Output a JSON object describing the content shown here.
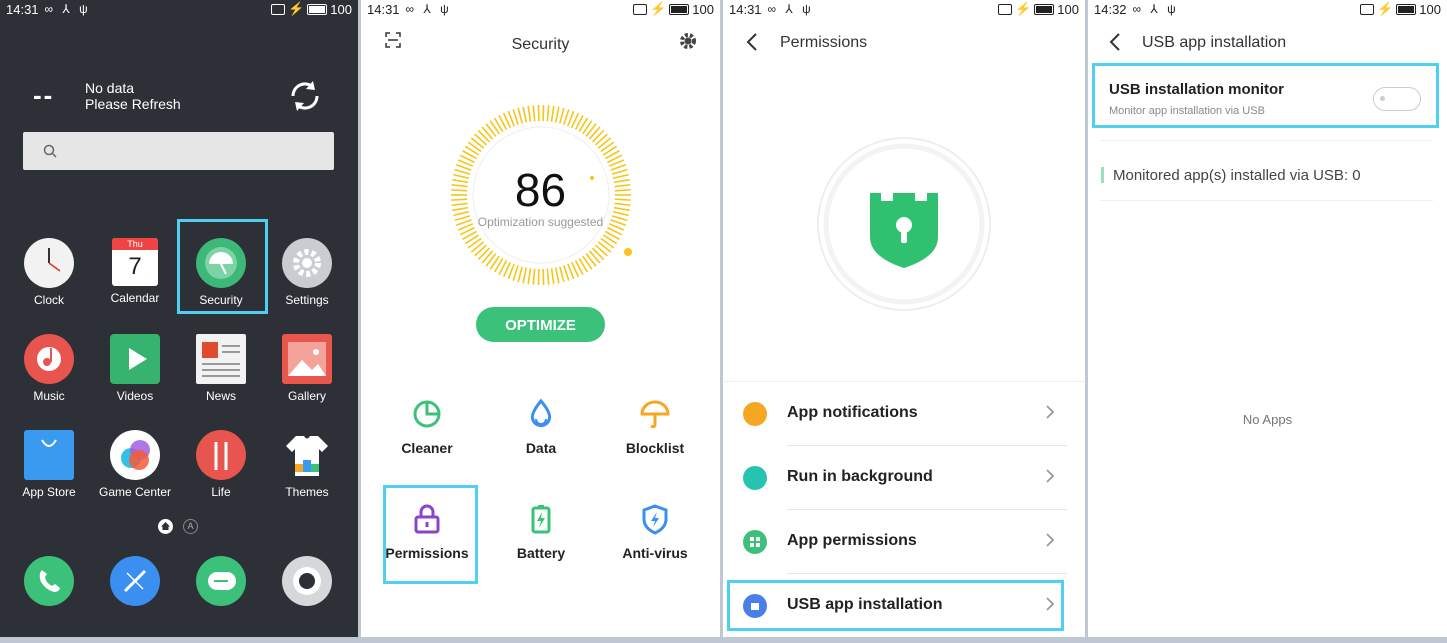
{
  "panel1": {
    "status": {
      "time": "14:31",
      "icons": "∞ ⅄ ψ",
      "battery": "100"
    },
    "weather": {
      "temp": "--",
      "line1": "No data",
      "line2": "Please Refresh"
    },
    "apps": [
      {
        "label": "Clock"
      },
      {
        "label": "Calendar"
      },
      {
        "label": "Security"
      },
      {
        "label": "Settings"
      },
      {
        "label": "Music"
      },
      {
        "label": "Videos"
      },
      {
        "label": "News"
      },
      {
        "label": "Gallery"
      },
      {
        "label": "App Store"
      },
      {
        "label": "Game Center"
      },
      {
        "label": "Life"
      },
      {
        "label": "Themes"
      }
    ],
    "calendar": {
      "day": "Thu",
      "date": "7"
    },
    "dock_dot": "A"
  },
  "panel2": {
    "status": {
      "time": "14:31",
      "icons": "∞ ⅄ ψ",
      "battery": "100"
    },
    "title": "Security",
    "score": "86",
    "score_sub": "Optimization suggested",
    "optimize_label": "OPTIMIZE",
    "tools": [
      {
        "label": "Cleaner"
      },
      {
        "label": "Data"
      },
      {
        "label": "Blocklist"
      },
      {
        "label": "Permissions"
      },
      {
        "label": "Battery"
      },
      {
        "label": "Anti-virus"
      }
    ]
  },
  "panel3": {
    "status": {
      "time": "14:31",
      "icons": "∞ ⅄ ψ",
      "battery": "100"
    },
    "title": "Permissions",
    "rows": [
      {
        "label": "App notifications",
        "color": "#f5a623"
      },
      {
        "label": "Run in background",
        "color": "#26c3b0"
      },
      {
        "label": "App permissions",
        "color": "#3cc17a"
      },
      {
        "label": "USB app installation",
        "color": "#4a7fe8"
      }
    ]
  },
  "panel4": {
    "status": {
      "time": "14:32",
      "icons": "∞ ⅄ ψ",
      "battery": "100"
    },
    "title": "USB app installation",
    "monitor_title": "USB installation monitor",
    "monitor_sub": "Monitor app installation via USB",
    "monitored_text": "Monitored app(s) installed via USB: 0",
    "no_apps": "No Apps"
  },
  "colors": {
    "accent_green": "#3cc17a",
    "highlight": "#4fd0f0",
    "gauge_yellow": "#f5c518"
  }
}
